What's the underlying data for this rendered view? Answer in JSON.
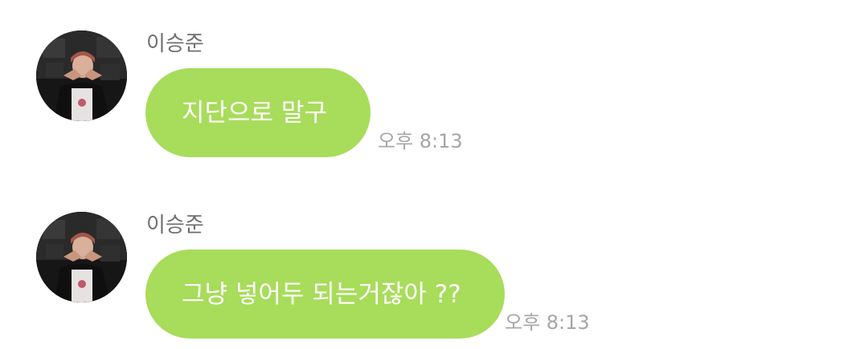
{
  "chat": {
    "messages": [
      {
        "sender": "이승준",
        "text": "지단으로 말구",
        "time": "오후 8:13"
      },
      {
        "sender": "이승준",
        "text": "그냥 넣어두 되는거잖아 ??",
        "time": "오후 8:13"
      }
    ]
  },
  "colors": {
    "bubble": "#a8dc5b",
    "bubble_text": "#ffffff",
    "sender_name": "#6f6f6f",
    "timestamp": "#a6a6a6"
  },
  "icons": {
    "avatar": "profile-photo"
  }
}
